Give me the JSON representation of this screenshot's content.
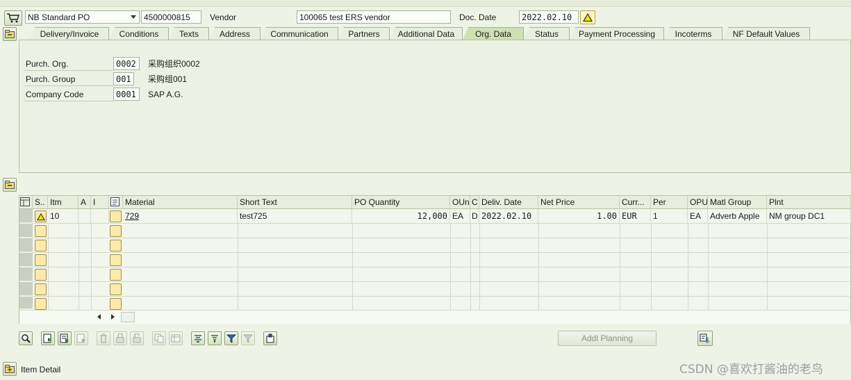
{
  "header": {
    "doc_type": "NB Standard PO",
    "po_number": "4500000815",
    "vendor_label": "Vendor",
    "vendor_value": "100065 test ERS vendor",
    "doc_date_label": "Doc. Date",
    "doc_date_value": "2022.02.10"
  },
  "tabs": [
    {
      "label": "Delivery/Invoice"
    },
    {
      "label": "Conditions"
    },
    {
      "label": "Texts"
    },
    {
      "label": "Address"
    },
    {
      "label": "Communication"
    },
    {
      "label": "Partners"
    },
    {
      "label": "Additional Data"
    },
    {
      "label": "Org. Data",
      "active": true
    },
    {
      "label": "Status"
    },
    {
      "label": "Payment Processing"
    },
    {
      "label": "Incoterms"
    },
    {
      "label": "NF Default Values"
    }
  ],
  "org_data": {
    "purch_org_label": "Purch. Org.",
    "purch_org_code": "0002",
    "purch_org_desc": "采购组织0002",
    "purch_group_label": "Purch. Group",
    "purch_group_code": "001",
    "purch_group_desc": "采购组001",
    "company_code_label": "Company Code",
    "company_code_value": "0001",
    "company_code_desc": "SAP A.G."
  },
  "grid": {
    "columns": [
      "S..",
      "Itm",
      "A",
      "I",
      "Material",
      "Short Text",
      "PO Quantity",
      "OUn",
      "C",
      "Deliv. Date",
      "Net Price",
      "Curr...",
      "Per",
      "OPU",
      "Matl Group",
      "Plnt"
    ],
    "rows": [
      {
        "itm": "10",
        "a": "",
        "i": "",
        "material": "729",
        "short_text": "test725",
        "po_quantity": "12,000",
        "oun": "EA",
        "c": "D",
        "deliv_date": "2022.02.10",
        "net_price": "1.00",
        "curr": "EUR",
        "per": "1",
        "opu": "EA",
        "matl_group": "Adverb Apple",
        "plnt": "NM group DC1"
      }
    ]
  },
  "addl_planning_label": "Addl Planning",
  "item_detail_label": "Item Detail",
  "watermark": "CSDN @喜欢打酱油的老鸟",
  "colors": {
    "accent": "#cfe0b4",
    "warning": "#f6e000"
  }
}
